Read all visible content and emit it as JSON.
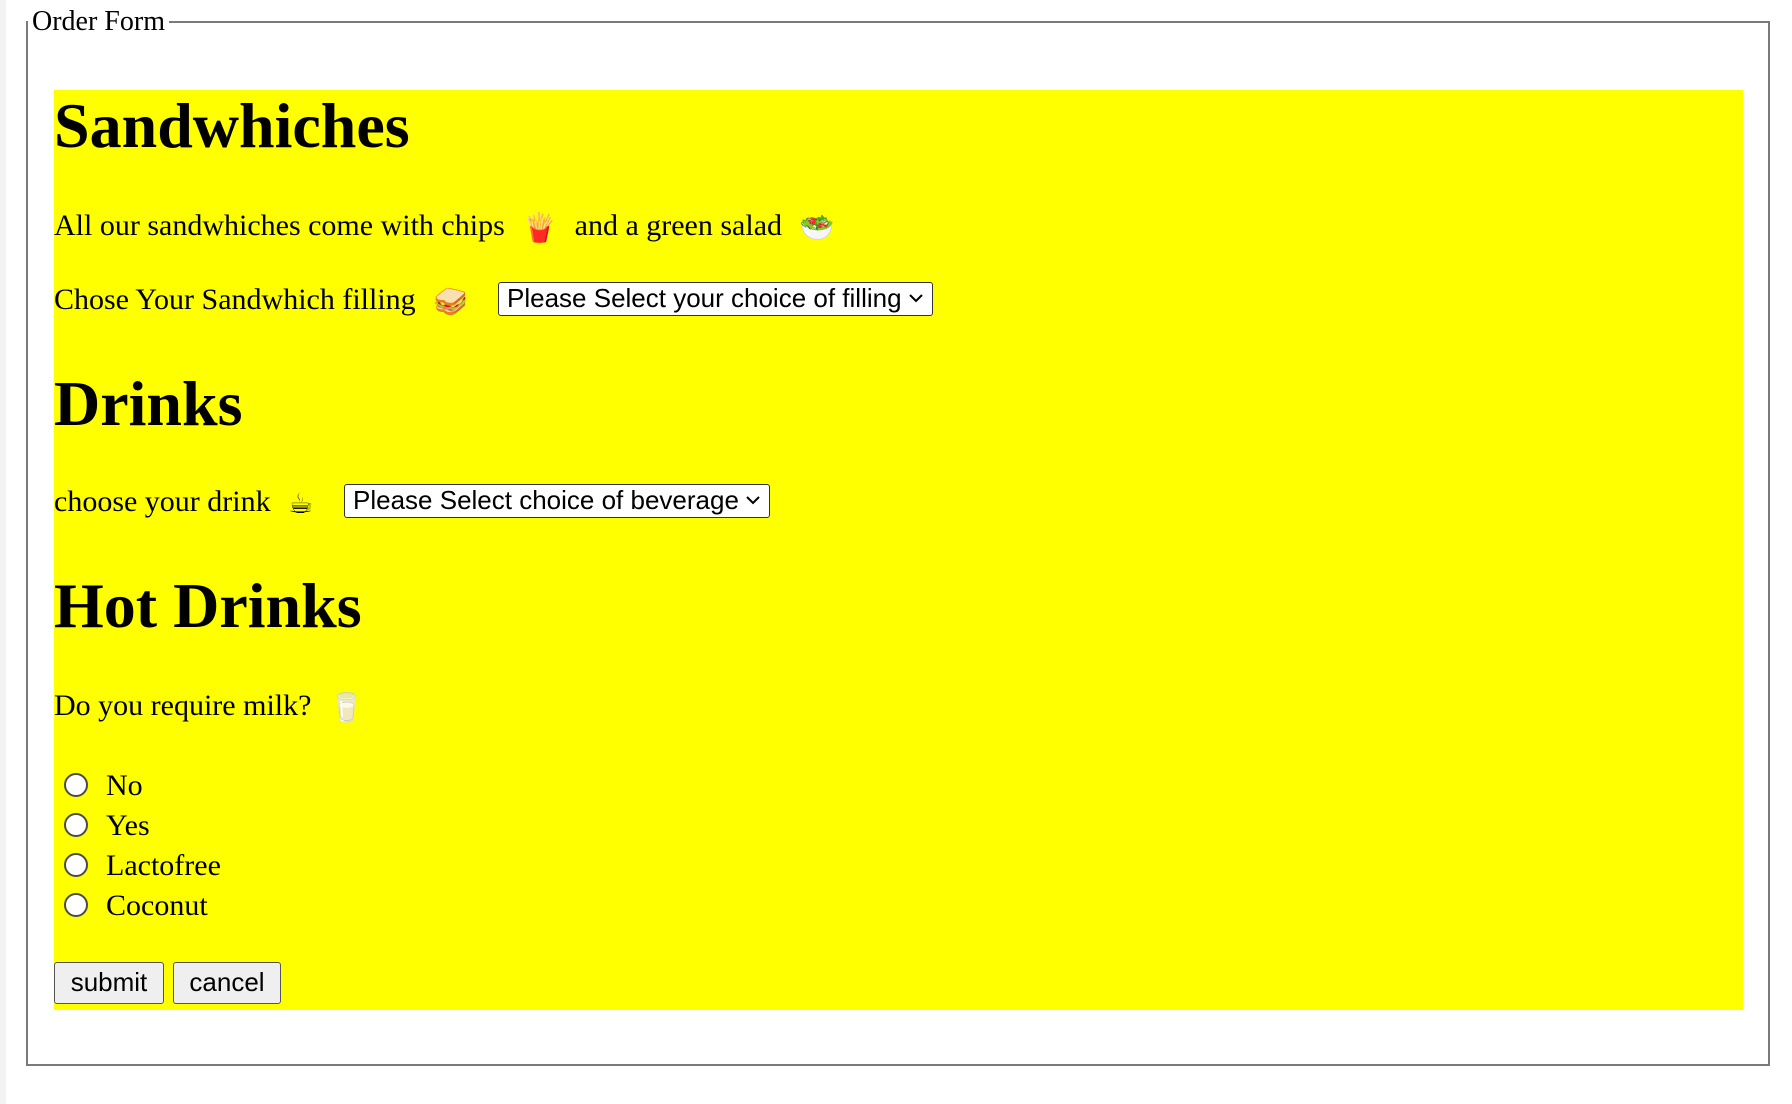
{
  "form": {
    "legend": "Order Form"
  },
  "sandwiches": {
    "heading": "Sandwhiches",
    "intro_before": "All our sandwhiches come with chips",
    "intro_mid": "and a green salad",
    "chips_emoji": "🍟",
    "salad_emoji": "🥗",
    "filling_label": "Chose Your Sandwhich filling",
    "sandwich_emoji": "🥪",
    "filling_select": "Please Select your choice of filling"
  },
  "drinks": {
    "heading": "Drinks",
    "drink_label": "choose your drink",
    "drink_emoji": "☕",
    "drink_select": "Please Select choice of beverage"
  },
  "hot_drinks": {
    "heading": "Hot Drinks",
    "milk_question": "Do you require milk?",
    "milk_emoji": "🥛",
    "options": [
      "No",
      "Yes",
      "Lactofree",
      "Coconut"
    ]
  },
  "buttons": {
    "submit": "submit",
    "cancel": "cancel"
  },
  "colors": {
    "section_background": "#ffff00",
    "border": "#7a7a7a"
  }
}
